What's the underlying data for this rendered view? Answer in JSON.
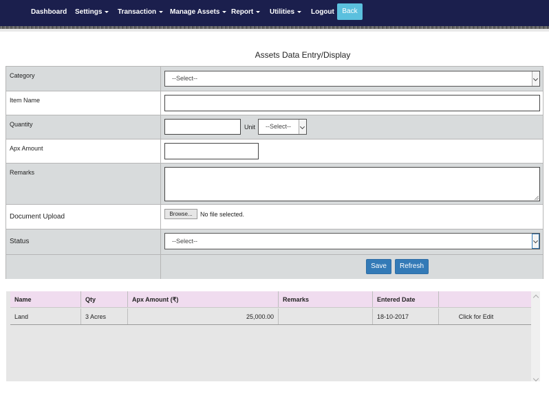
{
  "nav": {
    "items": [
      {
        "label": "Dashboard",
        "dropdown": false
      },
      {
        "label": "Settings",
        "dropdown": true
      },
      {
        "label": "Transaction",
        "dropdown": true
      },
      {
        "label": "Manage Assets",
        "dropdown": true
      },
      {
        "label": "Report",
        "dropdown": true
      },
      {
        "label": "Utilities",
        "dropdown": true
      },
      {
        "label": "Logout",
        "dropdown": false
      }
    ],
    "back_label": "Back"
  },
  "page": {
    "title": "Assets Data Entry/Display"
  },
  "form": {
    "category": {
      "label": "Category",
      "value": "--Select--"
    },
    "item_name": {
      "label": "Item Name",
      "value": ""
    },
    "quantity": {
      "label": "Quantity",
      "value": ""
    },
    "unit": {
      "label": "Unit",
      "value": "--Select--"
    },
    "apx_amount": {
      "label": "Apx Amount",
      "value": ""
    },
    "remarks": {
      "label": "Remarks",
      "value": ""
    },
    "document_upload": {
      "label": "Document Upload",
      "browse_label": "Browse...",
      "file_status": "No file selected."
    },
    "status": {
      "label": "Status",
      "value": "--Select--"
    },
    "save_label": "Save",
    "refresh_label": "Refresh"
  },
  "grid": {
    "columns": [
      "Name",
      "Qty",
      "Apx Amount (₹)",
      "Remarks",
      "Entered Date",
      ""
    ],
    "rows": [
      {
        "name": "Land",
        "qty": "3 Acres",
        "amount": "25,000.00",
        "remarks": "",
        "date": "18-10-2017",
        "action": "Click for Edit"
      }
    ]
  },
  "colors": {
    "navbar": "#1b1f4d",
    "back_button": "#5bc0de",
    "primary_button": "#337ab7",
    "row_gray": "#d8dbdc",
    "grid_header": "#f0dcef"
  }
}
